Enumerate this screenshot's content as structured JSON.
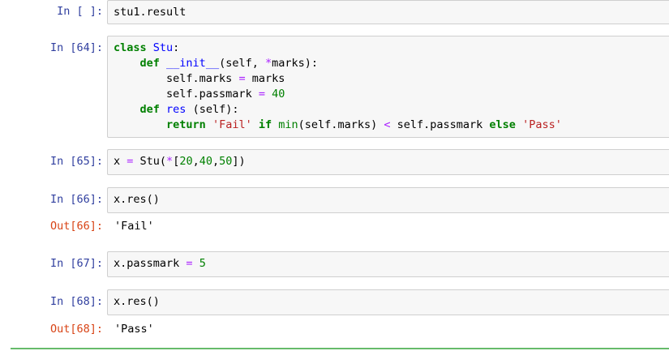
{
  "cells": [
    {
      "prompt": "In [ ]:",
      "code": "stu1.result"
    },
    {
      "prompt": "In [64]:",
      "code_lines": {
        "l1_kw": "class",
        "l1_name": "Stu",
        "l1_end": ":",
        "l2_indent": "    ",
        "l2_kw": "def",
        "l2_name": "__init__",
        "l2_a": "(self, ",
        "l2_op": "*",
        "l2_b": "marks):",
        "l3_indent": "        ",
        "l3_a": "self.marks ",
        "l3_op": "=",
        "l3_b": " marks",
        "l4_indent": "        ",
        "l4_a": "self.passmark ",
        "l4_op": "=",
        "l4_num": "40",
        "l5_indent": "    ",
        "l5_kw": "def",
        "l5_name": "res",
        "l5_b": " (self):",
        "l6_indent": "        ",
        "l6_kw1": "return",
        "l6_s1": "'Fail'",
        "l6_kw2": "if",
        "l6_bi": "min",
        "l6_a": "(self.marks) ",
        "l6_op": "<",
        "l6_b": " self.passmark ",
        "l6_kw3": "else",
        "l6_s2": "'Pass'"
      }
    },
    {
      "prompt": "In [65]:",
      "code_a": "x ",
      "code_op1": "=",
      "code_b": " Stu(",
      "code_op2": "*",
      "code_c": "[",
      "n1": "20",
      "n2": "40",
      "n3": "50",
      "code_d": "])"
    },
    {
      "prompt": "In [66]:",
      "code": "x.res()",
      "out_prompt": "Out[66]:",
      "output": "'Fail'"
    },
    {
      "prompt": "In [67]:",
      "code_a": "x.passmark ",
      "code_op": "=",
      "code_num": "5"
    },
    {
      "prompt": "In [68]:",
      "code": "x.res()",
      "out_prompt": "Out[68]:",
      "output": "'Pass'"
    }
  ],
  "colors": {
    "prompt_in": "#303f9f",
    "prompt_out": "#d84315",
    "keyword": "#008000",
    "string": "#ba2121",
    "operator": "#aa22ff",
    "function_name": "#0000ff",
    "cell_background": "#f7f7f7",
    "cell_border": "#cfcfcf",
    "selected_cell_rule": "#66bb6a"
  }
}
